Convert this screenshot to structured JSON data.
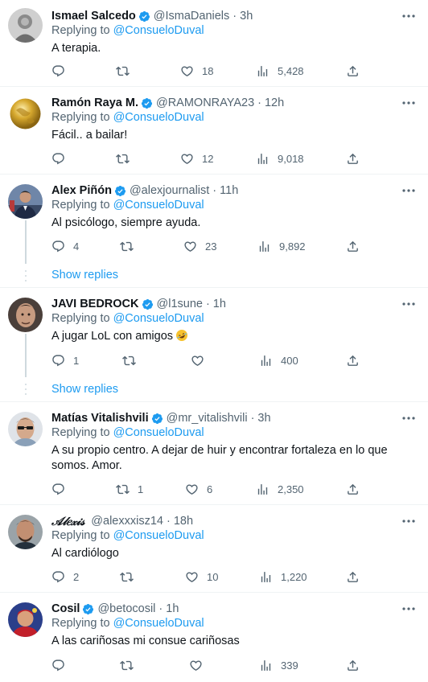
{
  "replying_prefix": "Replying to",
  "show_replies_label": "Show replies",
  "colors": {
    "accent": "#1d9bf0",
    "muted": "#536471",
    "text": "#0f1419",
    "thread_line": "#cfd9de"
  },
  "tweets": [
    {
      "name": "Ismael Salcedo",
      "verified": true,
      "handle": "@IsmaDaniels",
      "time": "3h",
      "replying_to": "@ConsueloDuval",
      "text": "A terapia.",
      "replies": "",
      "retweets": "",
      "likes": "18",
      "views": "5,428",
      "show_replies": false,
      "avatar": "photo-gray"
    },
    {
      "name": "Ramón Raya M.",
      "verified": true,
      "handle": "@RAMONRAYA23",
      "time": "12h",
      "replying_to": "@ConsueloDuval",
      "text": "Fácil.. a bailar!",
      "replies": "",
      "retweets": "",
      "likes": "12",
      "views": "9,018",
      "show_replies": false,
      "avatar": "gold-globe"
    },
    {
      "name": "Alex Piñón",
      "verified": true,
      "handle": "@alexjournalist",
      "time": "11h",
      "replying_to": "@ConsueloDuval",
      "text": "Al psicólogo, siempre ayuda.",
      "replies": "4",
      "retweets": "",
      "likes": "23",
      "views": "9,892",
      "show_replies": true,
      "avatar": "photo-suit"
    },
    {
      "name": "JAVI BEDROCK",
      "verified": true,
      "handle": "@l1sune",
      "time": "1h",
      "replying_to": "@ConsueloDuval",
      "text": "A jugar LoL con amigos",
      "emoji": "rolling-laughing-emoji",
      "replies": "1",
      "retweets": "",
      "likes": "",
      "views": "400",
      "show_replies": true,
      "avatar": "photo-face"
    },
    {
      "name": "Matías Vitalishvili",
      "verified": true,
      "handle": "@mr_vitalishvili",
      "time": "3h",
      "replying_to": "@ConsueloDuval",
      "text": "A su propio centro. A dejar de huir y encontrar fortaleza en lo que somos. Amor.",
      "replies": "",
      "retweets": "1",
      "likes": "6",
      "views": "2,350",
      "show_replies": false,
      "avatar": "photo-sunglasses"
    },
    {
      "name": "𝒜𝓁𝑒𝓍𝒾𝓈",
      "verified": false,
      "handle": "@alexxxisz14",
      "time": "18h",
      "replying_to": "@ConsueloDuval",
      "text": "Al cardiólogo",
      "replies": "2",
      "retweets": "",
      "likes": "10",
      "views": "1,220",
      "show_replies": false,
      "avatar": "photo-man"
    },
    {
      "name": "Cosil",
      "verified": true,
      "handle": "@betocosil",
      "time": "1h",
      "replying_to": "@ConsueloDuval",
      "text": "A las cariñosas mi consue cariñosas",
      "replies": "",
      "retweets": "",
      "likes": "",
      "views": "339",
      "show_replies": false,
      "avatar": "photo-red"
    }
  ]
}
